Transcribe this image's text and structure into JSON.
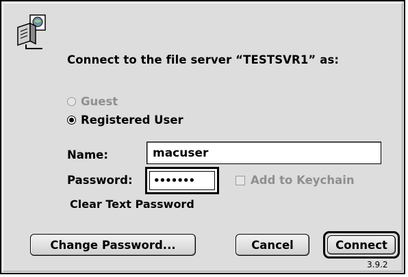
{
  "dialog": {
    "prompt": "Connect to the file server “TESTSVR1” as:",
    "icon": "network-server-icon"
  },
  "login_mode": {
    "guest_label": "Guest",
    "guest_enabled": false,
    "registered_label": "Registered User",
    "selected": "Registered User"
  },
  "name_field": {
    "label": "Name:",
    "value": "macuser"
  },
  "password_field": {
    "label": "Password:",
    "value": "•••••••"
  },
  "keychain": {
    "label": "Add to Keychain",
    "checked": false,
    "enabled": false
  },
  "auth_method": "Clear Text Password",
  "buttons": {
    "change_password": "Change Password...",
    "cancel": "Cancel",
    "connect": "Connect"
  },
  "version": "3.9.2",
  "colors": {
    "dialog_bg": "#dddddd",
    "disabled_text": "#8f8f8f"
  }
}
